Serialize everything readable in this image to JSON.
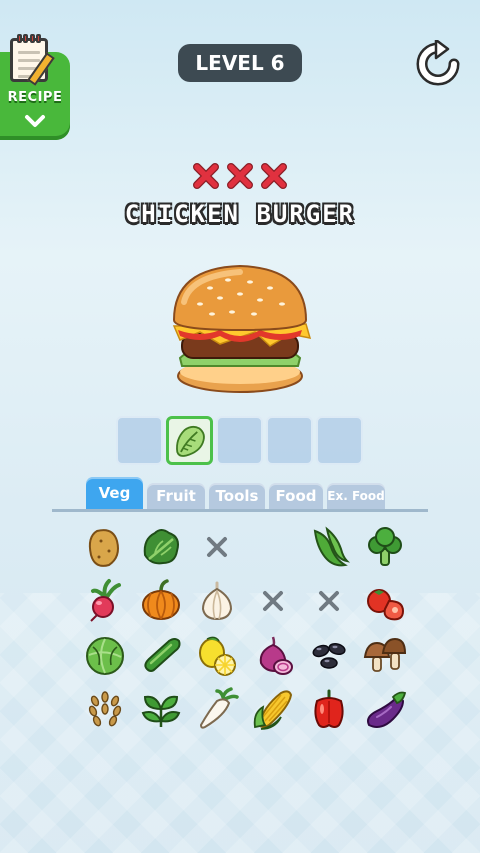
{
  "header": {
    "recipe_label": "RECIPE",
    "level_label": "LEVEL 6"
  },
  "game": {
    "strikes": 3,
    "dish_name": "CHICKEN BURGER",
    "answer_slots": [
      {
        "filled": false
      },
      {
        "filled": true,
        "item": "lettuce"
      },
      {
        "filled": false
      },
      {
        "filled": false
      },
      {
        "filled": false
      }
    ]
  },
  "tabs": [
    {
      "label": "Veg",
      "active": true
    },
    {
      "label": "Fruit",
      "active": false
    },
    {
      "label": "Tools",
      "active": false
    },
    {
      "label": "Food",
      "active": false
    },
    {
      "label": "Ex. Food",
      "active": false
    }
  ],
  "ingredients": [
    [
      "potato-icon",
      "broccoli-leaf-icon",
      "used-x-icon",
      "empty",
      "edamame-icon",
      "broccoli-icon"
    ],
    [
      "radish-icon",
      "pumpkin-icon",
      "garlic-icon",
      "used-x-icon",
      "used-x-icon",
      "tomato-icon"
    ],
    [
      "cabbage-icon",
      "cucumber-icon",
      "lemon-icon",
      "red-onion-icon",
      "black-beans-icon",
      "mushroom-icon"
    ],
    [
      "wheat-icon",
      "basil-icon",
      "daikon-icon",
      "corn-icon",
      "bell-pepper-icon",
      "eggplant-icon"
    ]
  ],
  "colors": {
    "accent_tab": "#3ea6ef",
    "inactive_tab": "#b5c9df",
    "strike_red": "#e0313f",
    "slot_highlight": "#4cc14a",
    "level_pill": "#3d4a52",
    "recipe_green": "#49b83b"
  }
}
